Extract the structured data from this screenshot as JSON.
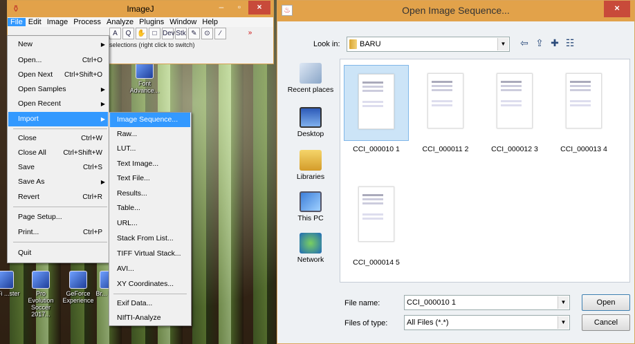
{
  "imagej": {
    "title": "ImageJ",
    "menus": [
      "File",
      "Edit",
      "Image",
      "Process",
      "Analyze",
      "Plugins",
      "Window",
      "Help"
    ],
    "toolbar": [
      "A",
      "Q",
      "✋",
      "□",
      "Dev",
      "Stk",
      "✎",
      "⊙",
      "∕",
      "»"
    ],
    "status": "selections (right click to switch)"
  },
  "file_menu": {
    "items": [
      {
        "label": "New",
        "shortcut": "",
        "submenu": true
      },
      {
        "label": "Open...",
        "shortcut": "Ctrl+O"
      },
      {
        "label": "Open Next",
        "shortcut": "Ctrl+Shift+O"
      },
      {
        "label": "Open Samples",
        "shortcut": "",
        "submenu": true
      },
      {
        "label": "Open Recent",
        "shortcut": "",
        "submenu": true
      },
      {
        "label": "Import",
        "shortcut": "",
        "submenu": true,
        "highlighted": true
      },
      {
        "label": "Close",
        "shortcut": "Ctrl+W"
      },
      {
        "label": "Close All",
        "shortcut": "Ctrl+Shift+W"
      },
      {
        "label": "Save",
        "shortcut": "Ctrl+S"
      },
      {
        "label": "Save As",
        "shortcut": "",
        "submenu": true
      },
      {
        "label": "Revert",
        "shortcut": "Ctrl+R"
      },
      {
        "label": "Page Setup...",
        "shortcut": ""
      },
      {
        "label": "Print...",
        "shortcut": "Ctrl+P"
      },
      {
        "label": "Quit",
        "shortcut": ""
      }
    ]
  },
  "import_menu": {
    "items": [
      "Image Sequence...",
      "Raw...",
      "LUT...",
      "Text Image...",
      "Text File...",
      "Results...",
      "Table...",
      "URL...",
      "Stack From List...",
      "TIFF Virtual Stack...",
      "AVI...",
      "XY Coordinates...",
      "Exif Data...",
      "NIfTI-Analyze"
    ]
  },
  "desktop": {
    "icons": [
      "Pro Evolution Soccer 2017...",
      "GeForce Experience",
      "Font Advance...",
      "WiFi ...ster",
      "Br... Uti..."
    ]
  },
  "dialog": {
    "title": "Open Image Sequence...",
    "look_in_label": "Look in:",
    "look_in_value": "BARU",
    "places": [
      "Recent places",
      "Desktop",
      "Libraries",
      "This PC",
      "Network"
    ],
    "files": [
      "CCI_000010 1",
      "CCI_000011 2",
      "CCI_000012 3",
      "CCI_000013 4",
      "CCI_000014 5"
    ],
    "selected_file": "CCI_000010 1",
    "file_name_label": "File name:",
    "file_name_value": "CCI_000010 1",
    "files_of_type_label": "Files of type:",
    "files_of_type_value": "All Files (*.*)",
    "open_label": "Open",
    "cancel_label": "Cancel"
  }
}
